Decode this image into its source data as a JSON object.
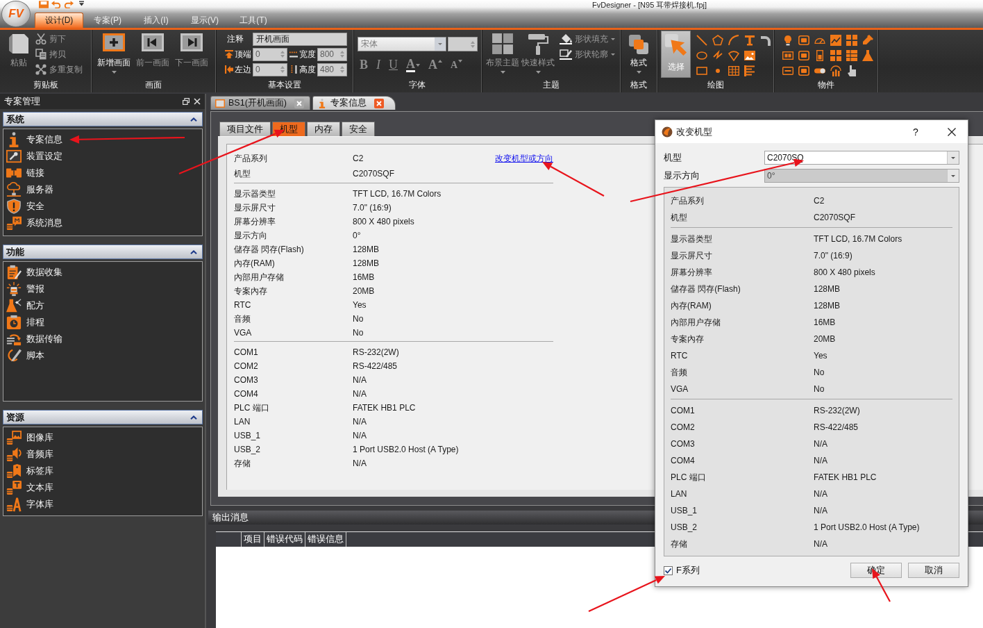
{
  "window": {
    "logo": "FV",
    "title": "FvDesigner - [N95 耳带焊接机.fpj]"
  },
  "ribbon": {
    "tabs": [
      {
        "label": "设计(D)",
        "selected": true
      },
      {
        "label": "专案(P)",
        "selected": false
      },
      {
        "label": "插入(I)",
        "selected": false
      },
      {
        "label": "显示(V)",
        "selected": false
      },
      {
        "label": "工具(T)",
        "selected": false
      }
    ],
    "clipboard": {
      "label": "剪贴板",
      "paste": {
        "label": "粘贴",
        "disabled": true
      },
      "items": [
        {
          "label": "剪下",
          "disabled": true
        },
        {
          "label": "拷贝",
          "disabled": true
        },
        {
          "label": "多重复制",
          "disabled": true
        }
      ]
    },
    "screen": {
      "label": "画面",
      "buttons": [
        {
          "label": "新增画面",
          "disabled": false,
          "dropdown": true
        },
        {
          "label": "前一画面",
          "disabled": true,
          "dropdown": false
        },
        {
          "label": "下一画面",
          "disabled": true,
          "dropdown": false
        }
      ]
    },
    "basic_settings": {
      "label": "基本设置",
      "note": {
        "label": "注释",
        "value": "开机画面"
      },
      "fields": [
        {
          "label": "顶端",
          "value": "0",
          "disabled": true
        },
        {
          "label": "宽度",
          "value": "800",
          "disabled": true
        },
        {
          "label": "左边",
          "value": "0",
          "disabled": true
        },
        {
          "label": "高度",
          "value": "480",
          "disabled": true
        }
      ]
    },
    "font": {
      "label": "字体",
      "font_name": {
        "value": "宋体",
        "disabled": true
      },
      "font_size": {
        "disabled": true
      },
      "buttons": [
        {
          "kind": "bold",
          "label": "B",
          "disabled": true
        },
        {
          "kind": "italic",
          "label": "I",
          "disabled": true
        },
        {
          "kind": "underline",
          "label": "U",
          "disabled": true
        },
        {
          "kind": "color",
          "label": "A",
          "disabled": true
        },
        {
          "kind": "grow",
          "label": "A",
          "disabled": true
        },
        {
          "kind": "shrink",
          "label": "A",
          "disabled": true
        }
      ]
    },
    "theme": {
      "label": "主题",
      "buttons": [
        {
          "label": "布景主题",
          "disabled": true
        },
        {
          "label": "快速样式",
          "disabled": true
        }
      ],
      "menus": [
        {
          "label": "形状填充",
          "disabled": true
        },
        {
          "label": "形状轮廓",
          "disabled": true
        }
      ]
    },
    "format": {
      "label": "格式",
      "button": {
        "label": "格式",
        "disabled": false
      }
    },
    "draw": {
      "label": "绘图",
      "select": {
        "label": "选择",
        "selected": true
      }
    },
    "objects": {
      "label": "物件"
    }
  },
  "project_panel": {
    "title": "专案管理",
    "sections": [
      {
        "title": "系统",
        "expanded": true,
        "items": [
          "专案信息",
          "装置设定",
          "链接",
          "服务器",
          "安全",
          "系统消息"
        ]
      },
      {
        "title": "功能",
        "expanded": true,
        "items": [
          "数据收集",
          "警报",
          "配方",
          "排程",
          "数据传输",
          "脚本"
        ]
      },
      {
        "title": "资源",
        "expanded": true,
        "items": [
          "图像库",
          "音频库",
          "标签库",
          "文本库",
          "字体库"
        ]
      }
    ]
  },
  "documents": {
    "tabs": [
      {
        "label": "BS1(开机画面)",
        "selected": false
      },
      {
        "label": "专案信息",
        "selected": true
      }
    ]
  },
  "project_info": {
    "tabs": [
      {
        "label": "项目文件",
        "selected": false
      },
      {
        "label": "机型",
        "selected": true
      },
      {
        "label": "内存",
        "selected": false
      },
      {
        "label": "安全",
        "selected": false
      }
    ],
    "link": "改变机型或方向",
    "groups": [
      {
        "rows": [
          {
            "label": "产品系列",
            "value": "C2"
          },
          {
            "label": "机型",
            "value": "C2070SQF"
          }
        ]
      },
      {
        "rows": [
          {
            "label": "显示器类型",
            "value": "TFT LCD, 16.7M Colors"
          },
          {
            "label": "显示屏尺寸",
            "value": "7.0\" (16:9)"
          },
          {
            "label": "屏幕分辨率",
            "value": "800 X 480 pixels"
          },
          {
            "label": "显示方向",
            "value": "0°"
          },
          {
            "label": "儲存器 閃存(Flash)",
            "value": "128MB"
          },
          {
            "label": "內存(RAM)",
            "value": "128MB"
          },
          {
            "label": "內部用户存储",
            "value": "16MB"
          },
          {
            "label": "专案內存",
            "value": "20MB"
          },
          {
            "label": "RTC",
            "value": "Yes"
          },
          {
            "label": "音频",
            "value": "No"
          },
          {
            "label": "VGA",
            "value": "No"
          }
        ]
      },
      {
        "rows": [
          {
            "label": "COM1",
            "value": "RS-232(2W)"
          },
          {
            "label": "COM2",
            "value": "RS-422/485"
          },
          {
            "label": "COM3",
            "value": "N/A"
          },
          {
            "label": "COM4",
            "value": "N/A"
          },
          {
            "label": "PLC 端口",
            "value": "FATEK HB1 PLC"
          },
          {
            "label": "LAN",
            "value": "N/A"
          },
          {
            "label": "USB_1",
            "value": "N/A"
          },
          {
            "label": "USB_2",
            "value": "1 Port USB2.0 Host (A Type)"
          },
          {
            "label": "存储",
            "value": "N/A"
          }
        ]
      }
    ]
  },
  "output": {
    "title": "输出消息",
    "columns": [
      "项目",
      "错误代码",
      "错误信息"
    ]
  },
  "dialog": {
    "title": "改变机型",
    "help": "?",
    "fields": [
      {
        "label": "机型",
        "value": "C2070SQ",
        "disabled": false
      },
      {
        "label": "显示方向",
        "value": "0°",
        "disabled": true
      }
    ],
    "groups": [
      {
        "rows": [
          {
            "label": "产品系列",
            "value": "C2"
          },
          {
            "label": "机型",
            "value": "C2070SQF"
          }
        ]
      },
      {
        "rows": [
          {
            "label": "显示器类型",
            "value": "TFT LCD, 16.7M Colors"
          },
          {
            "label": "显示屏尺寸",
            "value": "7.0\" (16:9)"
          },
          {
            "label": "屏幕分辨率",
            "value": "800 X 480 pixels"
          },
          {
            "label": "儲存器 閃存(Flash)",
            "value": "128MB"
          },
          {
            "label": "內存(RAM)",
            "value": "128MB"
          },
          {
            "label": "內部用户存储",
            "value": "16MB"
          },
          {
            "label": "专案內存",
            "value": "20MB"
          },
          {
            "label": "RTC",
            "value": "Yes"
          },
          {
            "label": "音频",
            "value": "No"
          },
          {
            "label": "VGA",
            "value": "No"
          }
        ]
      },
      {
        "rows": [
          {
            "label": "COM1",
            "value": "RS-232(2W)"
          },
          {
            "label": "COM2",
            "value": "RS-422/485"
          },
          {
            "label": "COM3",
            "value": "N/A"
          },
          {
            "label": "COM4",
            "value": "N/A"
          },
          {
            "label": "PLC 端口",
            "value": "FATEK HB1 PLC"
          },
          {
            "label": "LAN",
            "value": "N/A"
          },
          {
            "label": "USB_1",
            "value": "N/A"
          },
          {
            "label": "USB_2",
            "value": "1 Port USB2.0 Host (A Type)"
          },
          {
            "label": "存储",
            "value": "N/A"
          }
        ]
      }
    ],
    "checkbox": {
      "label": "F系列",
      "checked": true
    },
    "buttons": [
      "确定",
      "取消"
    ]
  }
}
